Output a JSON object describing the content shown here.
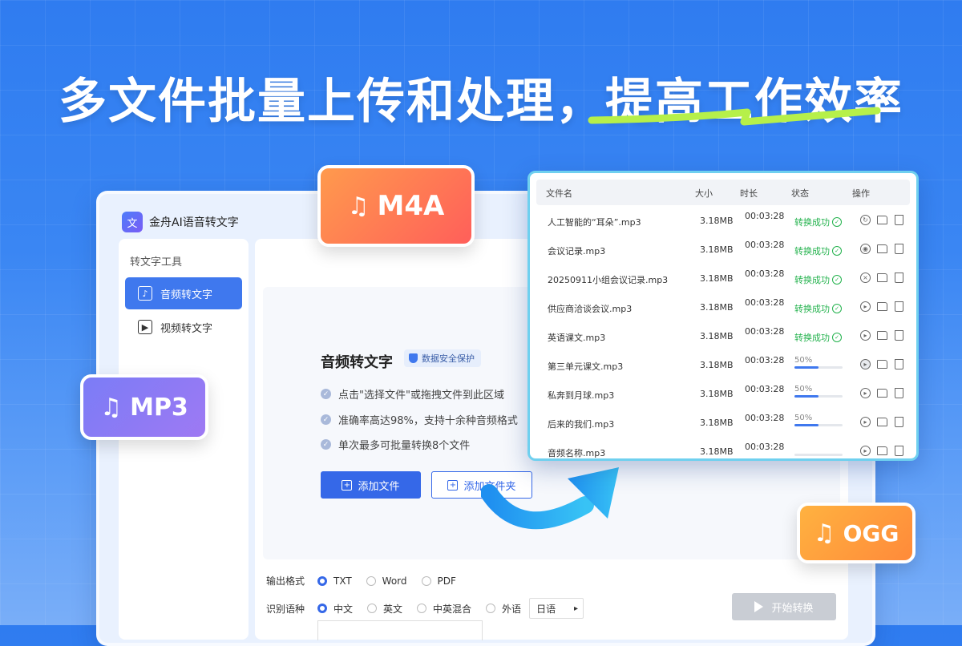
{
  "headline": {
    "part1": "多文件批量上传和处理，",
    "part2": "提高工作效率",
    "highlight_color": "#b6f04a"
  },
  "app": {
    "logo_icon": "translate-icon",
    "title": "金舟AI语音转文字",
    "sidebar": {
      "section": "转文字工具",
      "items": [
        {
          "label": "音频转文字",
          "icon": "audio-text-icon",
          "active": true
        },
        {
          "label": "视频转文字",
          "icon": "video-text-icon",
          "active": false
        }
      ]
    },
    "panel": {
      "title": "音频转文字",
      "secure_badge": "数据安全保护",
      "features": [
        "点击\"选择文件\"或拖拽文件到此区域",
        "准确率高达98%，支持十余种音频格式",
        "单次最多可批量转换8个文件"
      ],
      "add_file": "添加文件",
      "add_folder": "添加文件夹"
    },
    "options": {
      "output_label": "输出格式",
      "output_formats": [
        "TXT",
        "Word",
        "PDF"
      ],
      "output_selected": "TXT",
      "lang_label": "识别语种",
      "langs": [
        "中文",
        "英文",
        "中英混合",
        "外语"
      ],
      "lang_selected": "中文",
      "foreign_lang": "日语",
      "start": "开始转换"
    }
  },
  "file_list": {
    "headers": {
      "name": "文件名",
      "size": "大小",
      "duration": "时长",
      "status": "状态",
      "ops": "操作"
    },
    "rows": [
      {
        "name": "人工智能的“耳朵”.mp3",
        "size": "3.18MB",
        "duration": "00:03:28",
        "status": "转换成功",
        "progress": null,
        "op1": "refresh-icon"
      },
      {
        "name": "会议记录.mp3",
        "size": "3.18MB",
        "duration": "00:03:28",
        "status": "转换成功",
        "progress": null,
        "op1": "eye-icon"
      },
      {
        "name": "20250911小组会议记录.mp3",
        "size": "3.18MB",
        "duration": "00:03:28",
        "status": "转换成功",
        "progress": null,
        "op1": "cancel-icon"
      },
      {
        "name": "供应商洽谈会议.mp3",
        "size": "3.18MB",
        "duration": "00:03:28",
        "status": "转换成功",
        "progress": null,
        "op1": "play-icon"
      },
      {
        "name": "英语课文.mp3",
        "size": "3.18MB",
        "duration": "00:03:28",
        "status": "转换成功",
        "progress": null,
        "op1": "play-icon"
      },
      {
        "name": "第三单元课文.mp3",
        "size": "3.18MB",
        "duration": "00:03:28",
        "status": "50%",
        "progress": 0.5,
        "op1": "play-icon"
      },
      {
        "name": "私奔到月球.mp3",
        "size": "3.18MB",
        "duration": "00:03:28",
        "status": "50%",
        "progress": 0.5,
        "op1": "play-icon"
      },
      {
        "name": "后来的我们.mp3",
        "size": "3.18MB",
        "duration": "00:03:28",
        "status": "50%",
        "progress": 0.5,
        "op1": "play-icon"
      },
      {
        "name": "音频名称.mp3",
        "size": "3.18MB",
        "duration": "00:03:28",
        "status": "",
        "progress": 0,
        "op1": "play-icon"
      }
    ]
  },
  "badges": {
    "m4a": "M4A",
    "mp3": "MP3",
    "ogg": "OGG",
    "icon": "music-note-icon"
  },
  "colors": {
    "primary": "#3568e8",
    "success": "#22b24c",
    "bg": "#2f7cf0"
  }
}
